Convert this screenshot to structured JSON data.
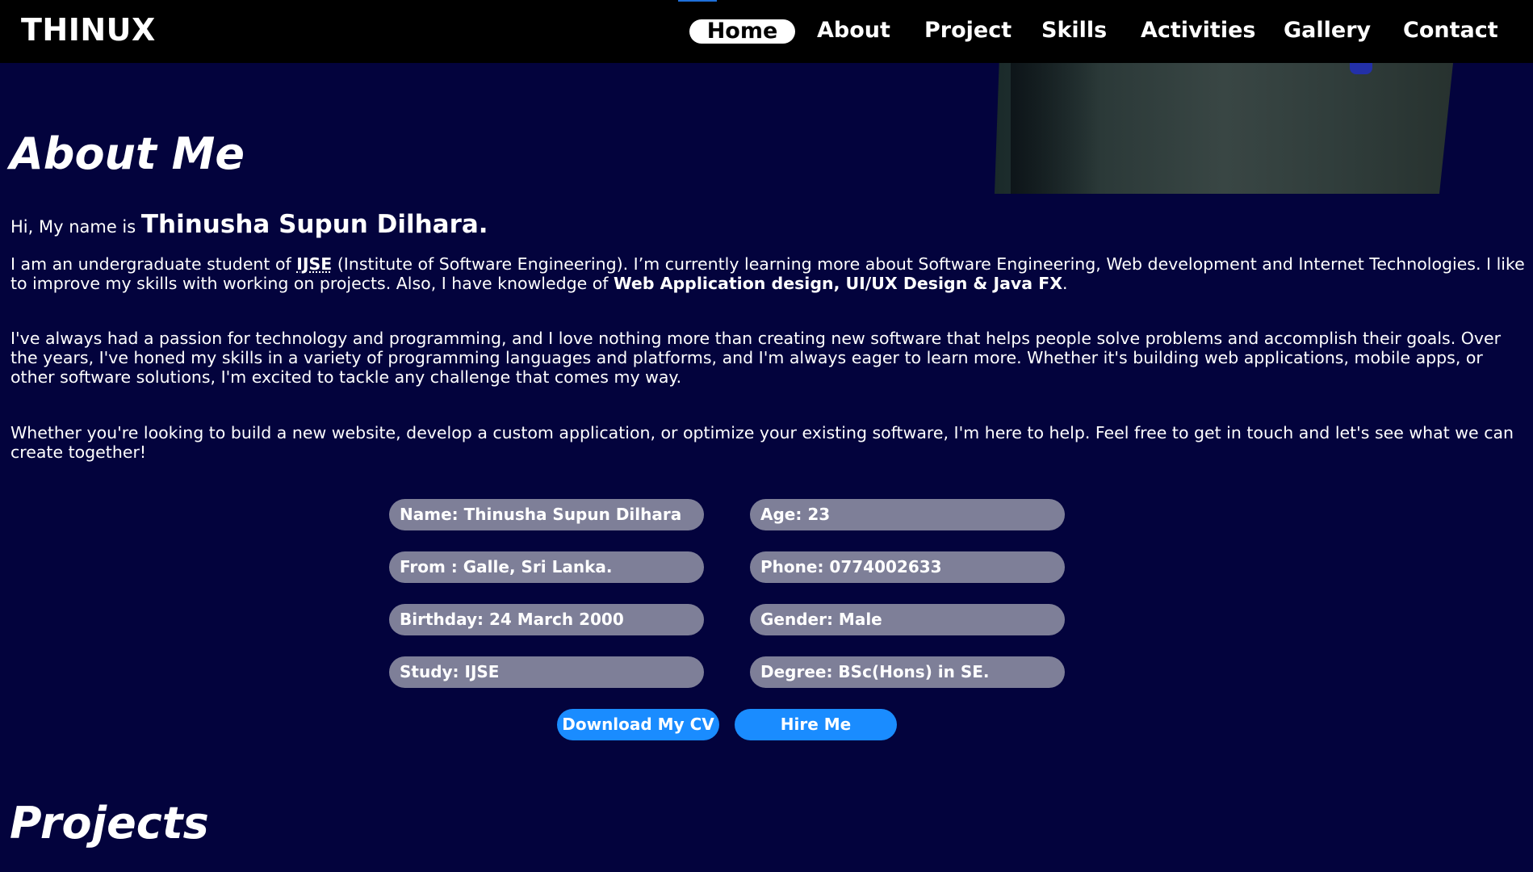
{
  "nav": {
    "brand": "THINUX",
    "links": [
      {
        "label": "Home",
        "active": true
      },
      {
        "label": "About"
      },
      {
        "label": "Project"
      },
      {
        "label": "Skills"
      },
      {
        "label": "Activities"
      },
      {
        "label": "Gallery"
      },
      {
        "label": "Contact"
      }
    ]
  },
  "about": {
    "title": "About Me",
    "intro_prefix": "Hi, My name is",
    "intro_name": "Thinusha Supun Dilhara.",
    "para1": {
      "pre": "I am an undergraduate student of ",
      "abbr": "IJSE",
      "mid": " (Institute of Software Engineering). I’m currently learning more about Software Engineering, Web development and Internet Technologies. I like to improve my skills with working on projects. Also, I have knowledge of ",
      "bold": "Web Application design, UI/UX Design & Java FX",
      "post": "."
    },
    "para2": "I've always had a passion for technology and programming, and I love nothing more than creating new software that helps people solve problems and accomplish their goals. Over the years, I've honed my skills in a variety of programming languages and platforms, and I'm always eager to learn more. Whether it's building web applications, mobile apps, or other software solutions, I'm excited to tackle any challenge that comes my way.",
    "para3": "Whether you're looking to build a new website, develop a custom application, or optimize your existing software, I'm here to help. Feel free to get in touch and let's see what we can create together!",
    "info": [
      "Name: Thinusha Supun Dilhara",
      "Age: 23",
      "From : Galle, Sri Lanka.",
      "Phone: 0774002633",
      "Birthday: 24 March 2000",
      "Gender: Male",
      "Study: IJSE",
      "Degree: BSc(Hons) in SE."
    ],
    "buttons": {
      "download_cv": "Download My CV",
      "hire_me": "Hire Me"
    }
  },
  "projects": {
    "title": "Projects"
  },
  "colors": {
    "background": "#03033d",
    "navbar": "#000000",
    "pill": "#7e7f98",
    "button": "#1a8cff"
  }
}
